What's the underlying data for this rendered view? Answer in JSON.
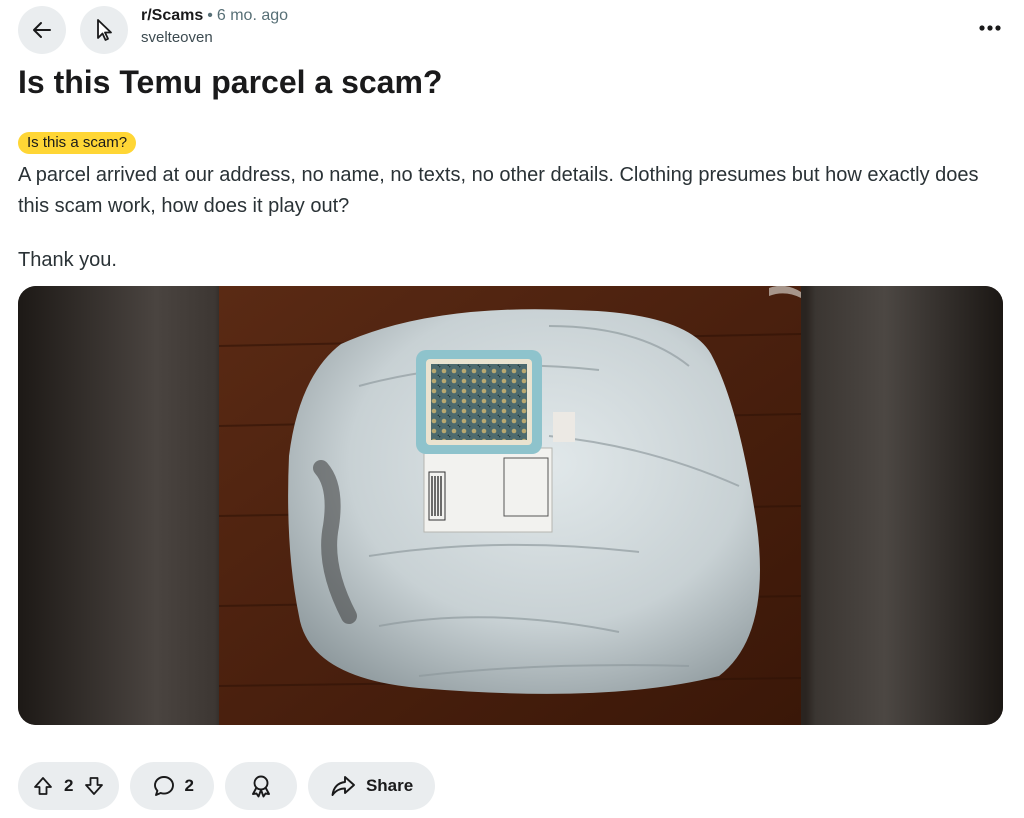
{
  "post": {
    "subreddit": "r/Scams",
    "age": "6 mo. ago",
    "author": "svelteoven",
    "title": "Is this Temu parcel a scam?",
    "flair": "Is this a scam?",
    "body": [
      "A parcel arrived at our address, no name, no texts, no other details. Clothing presumes but how exactly does this scam work, how does it play out?",
      "Thank you."
    ]
  },
  "actions": {
    "upvotes": "2",
    "comments": "2",
    "share_label": "Share"
  },
  "icons": {
    "back": "arrow-left-icon",
    "subreddit": "cursor-pointer-icon",
    "more": "ellipsis-icon",
    "upvote": "arrow-up-icon",
    "downvote": "arrow-down-icon",
    "comment": "speech-bubble-icon",
    "award": "award-icon",
    "share": "share-arrow-icon"
  },
  "colors": {
    "flair_bg": "#ffd635",
    "pill_bg": "#eaedef",
    "text": "#1a1a1b",
    "muted": "#576f76"
  }
}
